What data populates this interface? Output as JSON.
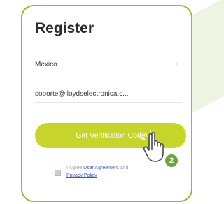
{
  "screen": {
    "title": "Register",
    "country": {
      "value": "Mexico"
    },
    "email": {
      "value": "soporte@lloydselectronica.c..."
    },
    "button": {
      "label": "Get Verification Code"
    },
    "agreement": {
      "prefix": "I Agree",
      "user_agreement": "User Agreement",
      "and": "and",
      "privacy_policy": "Privacy Policy"
    },
    "step_badge": "2"
  },
  "colors": {
    "accent": "#c7d42a",
    "border": "#8fbc3a",
    "badge": "#6ba83a",
    "link": "#3b5db0"
  },
  "icons": [
    "chevron-right-icon",
    "tap-hand-icon",
    "checkbox-icon"
  ]
}
